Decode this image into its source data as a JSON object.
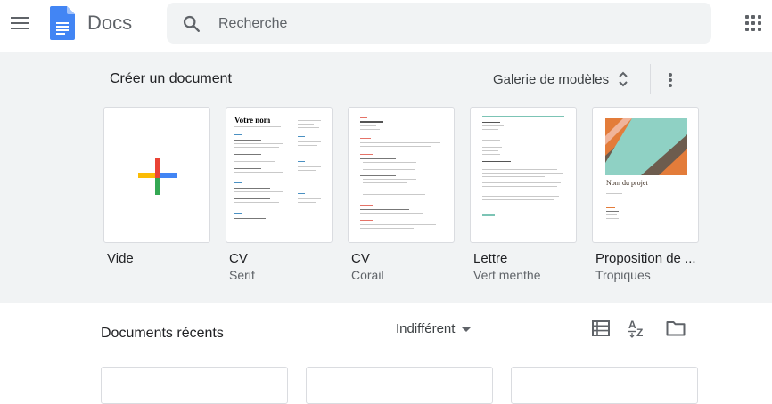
{
  "header": {
    "app_title": "Docs",
    "search_placeholder": "Recherche"
  },
  "templates": {
    "section_title": "Créer un document",
    "gallery_label": "Galerie de modèles",
    "items": [
      {
        "name": "Vide",
        "subtitle": ""
      },
      {
        "name": "CV",
        "subtitle": "Serif",
        "preview_heading": "Votre nom"
      },
      {
        "name": "CV",
        "subtitle": "Corail"
      },
      {
        "name": "Lettre",
        "subtitle": "Vert menthe"
      },
      {
        "name": "Proposition de ...",
        "subtitle": "Tropiques",
        "preview_heading": "Nom du projet"
      }
    ]
  },
  "recent": {
    "title": "Documents récents",
    "owner_filter": "Indifférent"
  },
  "colors": {
    "docs_blue": "#4285f4",
    "template_bg": "#f1f3f4",
    "coral": "#e57368",
    "mint": "#7cc4b5",
    "tropics_orange": "#e37c3a"
  }
}
